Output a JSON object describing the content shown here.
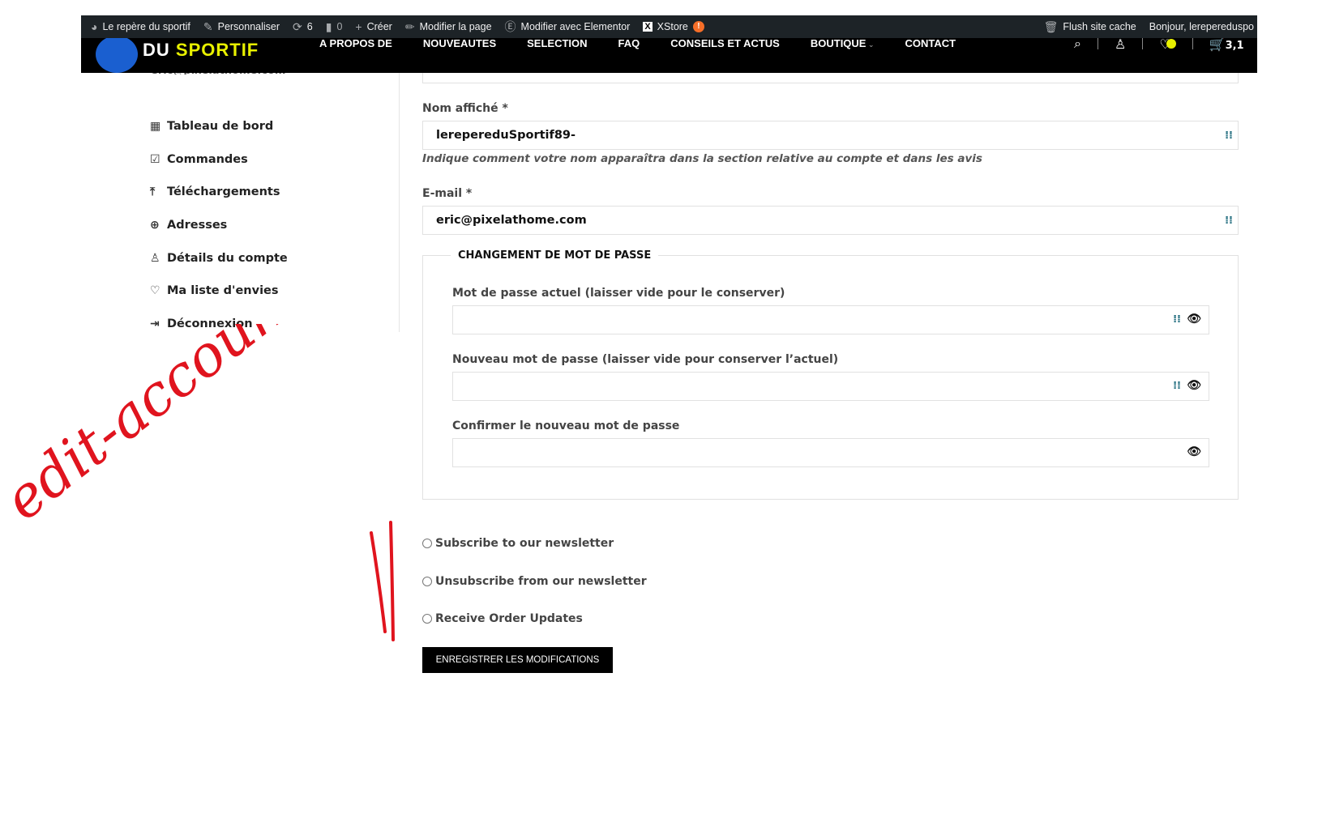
{
  "admin_bar": {
    "site": "Le repère du sportif",
    "customize": "Personnaliser",
    "updates": "6",
    "comments": "0",
    "new": "Créer",
    "edit_page": "Modifier la page",
    "elementor": "Modifier avec Elementor",
    "xstore": "XStore",
    "xstore_badge": "!",
    "flush": "Flush site cache",
    "greeting": "Bonjour, lerepereduspo"
  },
  "nav": {
    "logo": "LE REPÈRE DU SPORTIF",
    "logo_a": "DU",
    "logo_b": "SPORTIF",
    "items": [
      "A PROPOS DE",
      "NOUVEAUTES",
      "SELECTION",
      "FAQ",
      "CONSEILS ET ACTUS",
      "BOUTIQUE",
      "CONTACT"
    ],
    "cart_total": "3,1"
  },
  "sidebar": {
    "email": "eric@pixelathome.com",
    "items": [
      {
        "label": "Tableau de bord",
        "icon": "dashboard-icon"
      },
      {
        "label": "Commandes",
        "icon": "orders-icon"
      },
      {
        "label": "Téléchargements",
        "icon": "download-icon"
      },
      {
        "label": "Adresses",
        "icon": "globe-icon"
      },
      {
        "label": "Détails du compte",
        "icon": "user-icon"
      },
      {
        "label": "Ma liste d'envies",
        "icon": "heart-icon"
      },
      {
        "label": "Déconnexion",
        "icon": "logout-icon"
      }
    ]
  },
  "form": {
    "display_name_label": "Nom affiché *",
    "display_name": "lerepereduSportif89-",
    "display_name_help": "Indique comment votre nom apparaîtra dans la section relative au compte et dans les avis",
    "email_label": "E-mail *",
    "email": "eric@pixelathome.com",
    "password_legend": "CHANGEMENT DE MOT DE PASSE",
    "current_pw_label": "Mot de passe actuel (laisser vide pour le conserver)",
    "new_pw_label": "Nouveau mot de passe (laisser vide pour conserver l’actuel)",
    "confirm_pw_label": "Confirmer le nouveau mot de passe",
    "subscribe": "Subscribe to our newsletter",
    "unsubscribe": "Unsubscribe from our newsletter",
    "order_updates": "Receive Order Updates",
    "save": "ENREGISTRER LES MODIFICATIONS"
  },
  "annotation": {
    "text": "edit-account",
    "color": "#e0141e"
  }
}
